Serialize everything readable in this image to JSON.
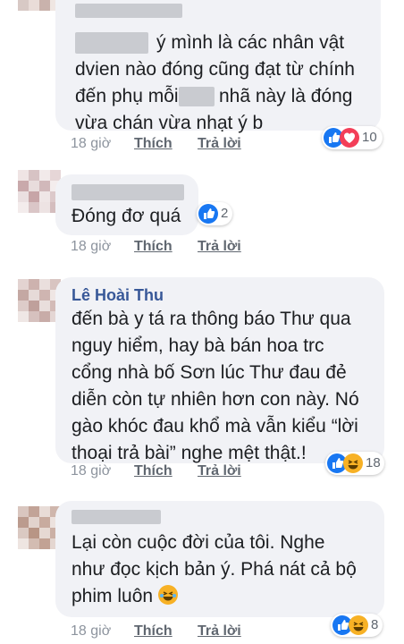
{
  "comments": [
    {
      "text_lines": [
        "ý mình là các nhân vật",
        "dvien nào đóng cũng đạt từ chính",
        "đến phụ mỗi",
        "nhã này là đóng",
        "vừa chán vừa nhạt ý b"
      ],
      "time": "18 giờ",
      "like": "Thích",
      "reply": "Trả lời",
      "reactions": {
        "icons": [
          "like-icon",
          "love-icon"
        ],
        "count": "10"
      }
    },
    {
      "text_lines": [
        "Đóng đơ quá"
      ],
      "time": "18 giờ",
      "like": "Thích",
      "reply": "Trả lời",
      "reactions": {
        "icons": [
          "like-icon"
        ],
        "count": "2"
      }
    },
    {
      "author": "Lê Hoài Thu",
      "text_lines": [
        "đến bà y tá ra thông báo Thư qua",
        "nguy hiểm, hay bà bán hoa trc",
        "cổng nhà bố Sơn lúc Thư đau đẻ",
        "diễn còn tự nhiên hơn con này. Nó",
        "gào khóc đau khổ mà vẫn kiểu “lời",
        "thoại trả bài” nghe mệt thật.!"
      ],
      "time": "18 giờ",
      "like": "Thích",
      "reply": "Trả lời",
      "reactions": {
        "icons": [
          "like-icon",
          "haha-icon"
        ],
        "count": "18"
      }
    },
    {
      "text_lines": [
        "Lại còn cuộc đời của tôi. Nghe",
        "như đọc kịch bản ý. Phá nát cả bộ",
        "phim luôn"
      ],
      "inline_emoji": "laughing-emoji-icon",
      "time": "18 giờ",
      "like": "Thích",
      "reply": "Trả lời",
      "reactions": {
        "icons": [
          "like-icon",
          "haha-icon"
        ],
        "count": "8"
      }
    }
  ],
  "colors": {
    "bubble": "#f1f2f6",
    "author": "#385898",
    "meta": "#8d949e",
    "like": "#1877f2",
    "love": "#f33e58",
    "haha": "#f7b125"
  }
}
